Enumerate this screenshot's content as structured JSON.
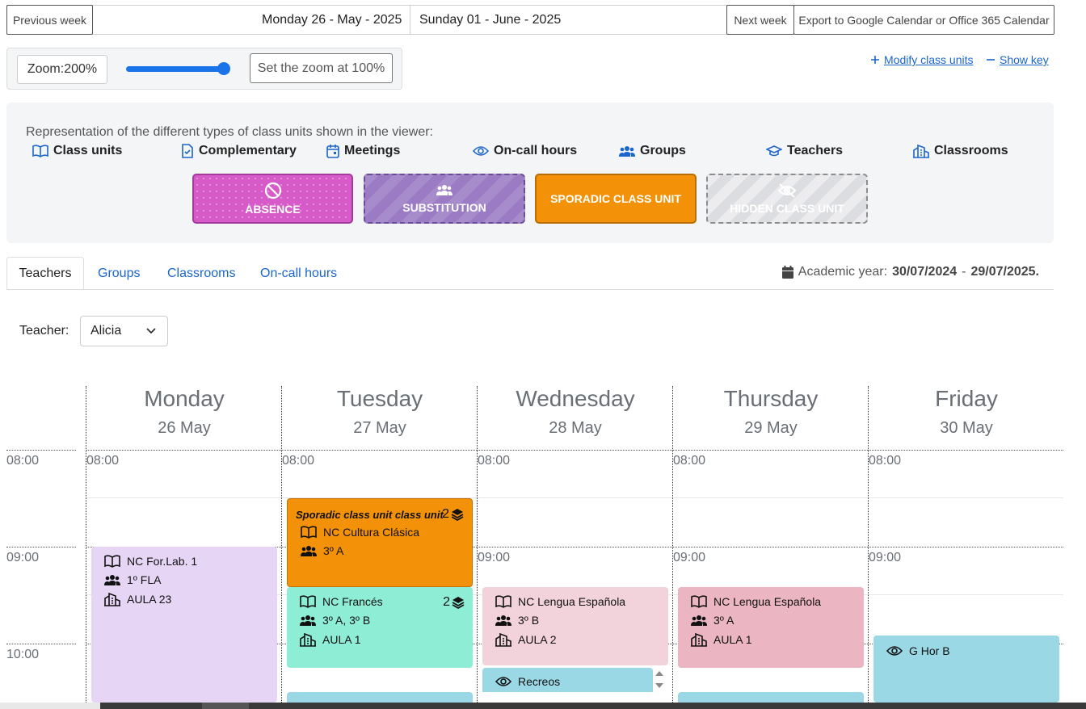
{
  "week_nav": {
    "prev_label": "Previous week",
    "start_date": "Monday 26 - May - 2025",
    "end_date": "Sunday 01 - June - 2025",
    "next_label": "Next week",
    "export_label": "Export to Google Calendar or Office 365 Calendar"
  },
  "zoom": {
    "label": "Zoom:200%",
    "level_percent": 200,
    "slider_fraction": 1.0,
    "reset_label": "Set the zoom at 100%"
  },
  "links": {
    "modify": "Modify class units",
    "show_key": "Show key"
  },
  "key": {
    "title": "Representation of the different types of class units shown in the viewer:",
    "items": [
      {
        "label": "Class units",
        "icon": "book-icon"
      },
      {
        "label": "Complementary",
        "icon": "file-check-icon"
      },
      {
        "label": "Meetings",
        "icon": "calendar-icon"
      },
      {
        "label": "On-call hours",
        "icon": "eye-icon"
      },
      {
        "label": "Groups",
        "icon": "users-icon"
      },
      {
        "label": "Teachers",
        "icon": "graduation-cap-icon"
      },
      {
        "label": "Classrooms",
        "icon": "building-icon"
      }
    ],
    "boxes": [
      {
        "label": "ABSENCE",
        "icon": "ban-icon",
        "color": "#d65bc9"
      },
      {
        "label": "SUBSTITUTION",
        "icon": "users-icon",
        "color": "#9b7cc4"
      },
      {
        "label": "SPORADIC CLASS UNIT",
        "color": "#f39208"
      },
      {
        "label": "HIDDEN CLASS UNIT",
        "icon": "eye-slash-icon",
        "color": "#dcdde0"
      }
    ]
  },
  "tabs": [
    "Teachers",
    "Groups",
    "Classrooms",
    "On-call hours"
  ],
  "academic_year": {
    "label": "Academic year:",
    "start": "30/07/2024",
    "sep": "-",
    "end": "29/07/2025."
  },
  "teacher_select": {
    "label": "Teacher:",
    "value": "Alicia"
  },
  "calendar": {
    "days": [
      {
        "name": "Monday",
        "date": "26 May"
      },
      {
        "name": "Tuesday",
        "date": "27 May"
      },
      {
        "name": "Wednesday",
        "date": "28 May"
      },
      {
        "name": "Thursday",
        "date": "29 May"
      },
      {
        "name": "Friday",
        "date": "30 May"
      }
    ],
    "times": [
      "08:00",
      "09:00",
      "10:00"
    ],
    "events": {
      "mon_1": {
        "subject": "NC For.Lab. 1",
        "group": "1º FLA",
        "room": "AULA 23",
        "color": "#e6d5f5"
      },
      "tue_sporadic": {
        "title": "Sporadic class unit class unit",
        "count": "2",
        "subject": "NC Cultura Clásica",
        "group": "3º A",
        "color": "#f39208"
      },
      "tue_2": {
        "subject": "NC Francés",
        "count": "2",
        "group": "3º A, 3º B",
        "room": "AULA 1",
        "color": "#8eedd5"
      },
      "wed_1": {
        "subject": "NC Lengua Española",
        "group": "3º B",
        "room": "AULA 2",
        "color": "#f2d3db"
      },
      "wed_2": {
        "label": "Recreos",
        "color": "#99d8e4"
      },
      "thu_1": {
        "subject": "NC Lengua Española",
        "group": "3º A",
        "room": "AULA 1",
        "color": "#ebb5c2"
      },
      "fri_1": {
        "label": "G Hor B",
        "color": "#99d8e4"
      }
    }
  }
}
